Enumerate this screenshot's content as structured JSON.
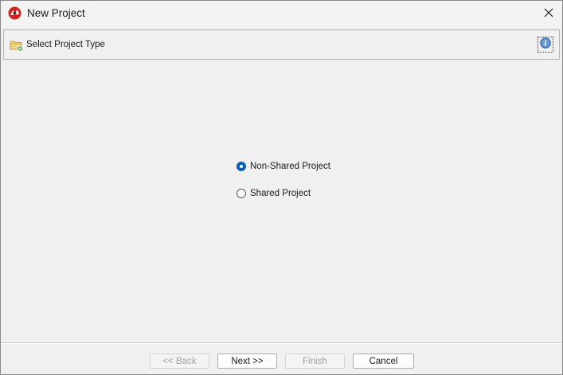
{
  "window": {
    "title": "New Project"
  },
  "header": {
    "title": "Select Project Type"
  },
  "options": [
    {
      "label": "Non-Shared Project",
      "selected": true
    },
    {
      "label": "Shared Project",
      "selected": false
    }
  ],
  "footer": {
    "back_label": "<< Back",
    "next_label": "Next >>",
    "finish_label": "Finish",
    "cancel_label": "Cancel"
  },
  "icons": {
    "app": "app-logo-icon",
    "close": "close-icon",
    "header": "folder-icon",
    "info": "info-icon"
  },
  "colors": {
    "accent": "#0a5fb4",
    "window_bg": "#f0f0f0",
    "disabled_text": "#a0a0a0"
  }
}
